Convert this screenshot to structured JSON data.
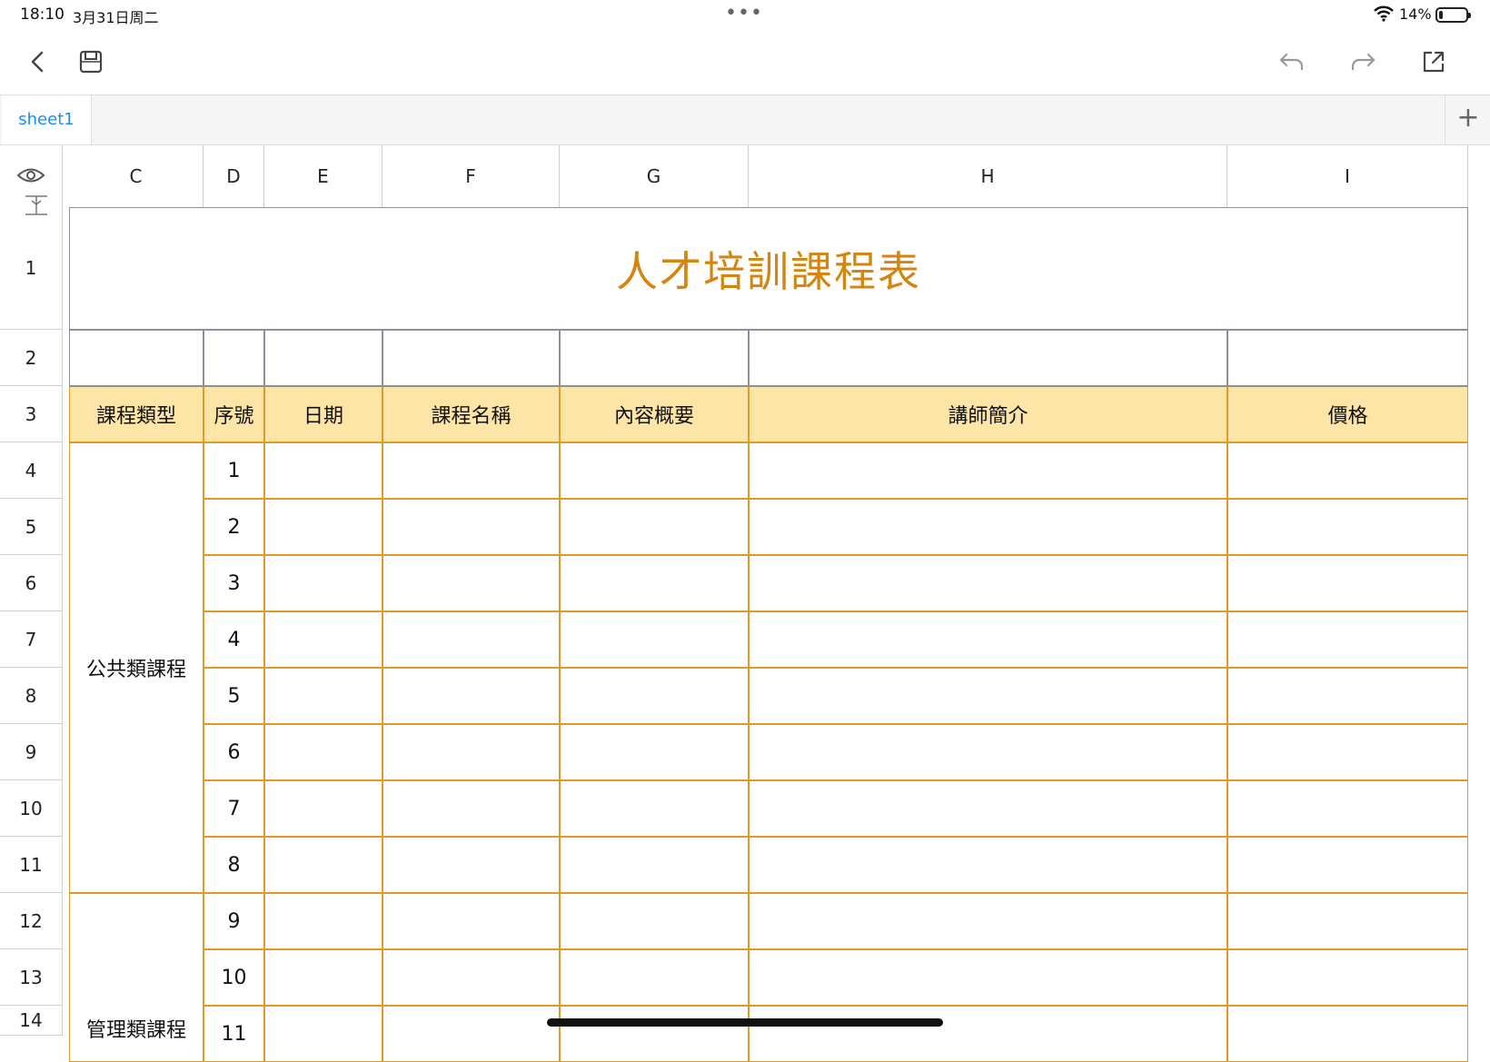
{
  "status_bar": {
    "time": "18:10",
    "date": "3月31日周二",
    "battery": "14%",
    "battery_level": 0.14
  },
  "toolbar": {
    "icons": [
      "back-icon",
      "save-icon",
      "undo-icon",
      "redo-icon",
      "share-icon"
    ]
  },
  "tabs": [
    {
      "label": "sheet1"
    }
  ],
  "add_tab_label": "+",
  "columns": [
    "C",
    "D",
    "E",
    "F",
    "G",
    "H",
    "I"
  ],
  "rows": [
    "1",
    "2",
    "3",
    "4",
    "5",
    "6",
    "7",
    "8",
    "9",
    "10",
    "11",
    "12",
    "13",
    "14"
  ],
  "sheet": {
    "title": "人才培訓課程表",
    "headers": [
      "課程類型",
      "序號",
      "日期",
      "課程名稱",
      "內容概要",
      "講師簡介",
      "價格"
    ],
    "categories": [
      "公共類課程",
      "管理類課程"
    ],
    "numbers": [
      "1",
      "2",
      "3",
      "4",
      "5",
      "6",
      "7",
      "8",
      "9",
      "10",
      "11"
    ]
  },
  "colors": {
    "title": "#d4850f",
    "header_fill": "#fde5a8",
    "border": "#e09a2a",
    "accent": "#1a8cff"
  }
}
